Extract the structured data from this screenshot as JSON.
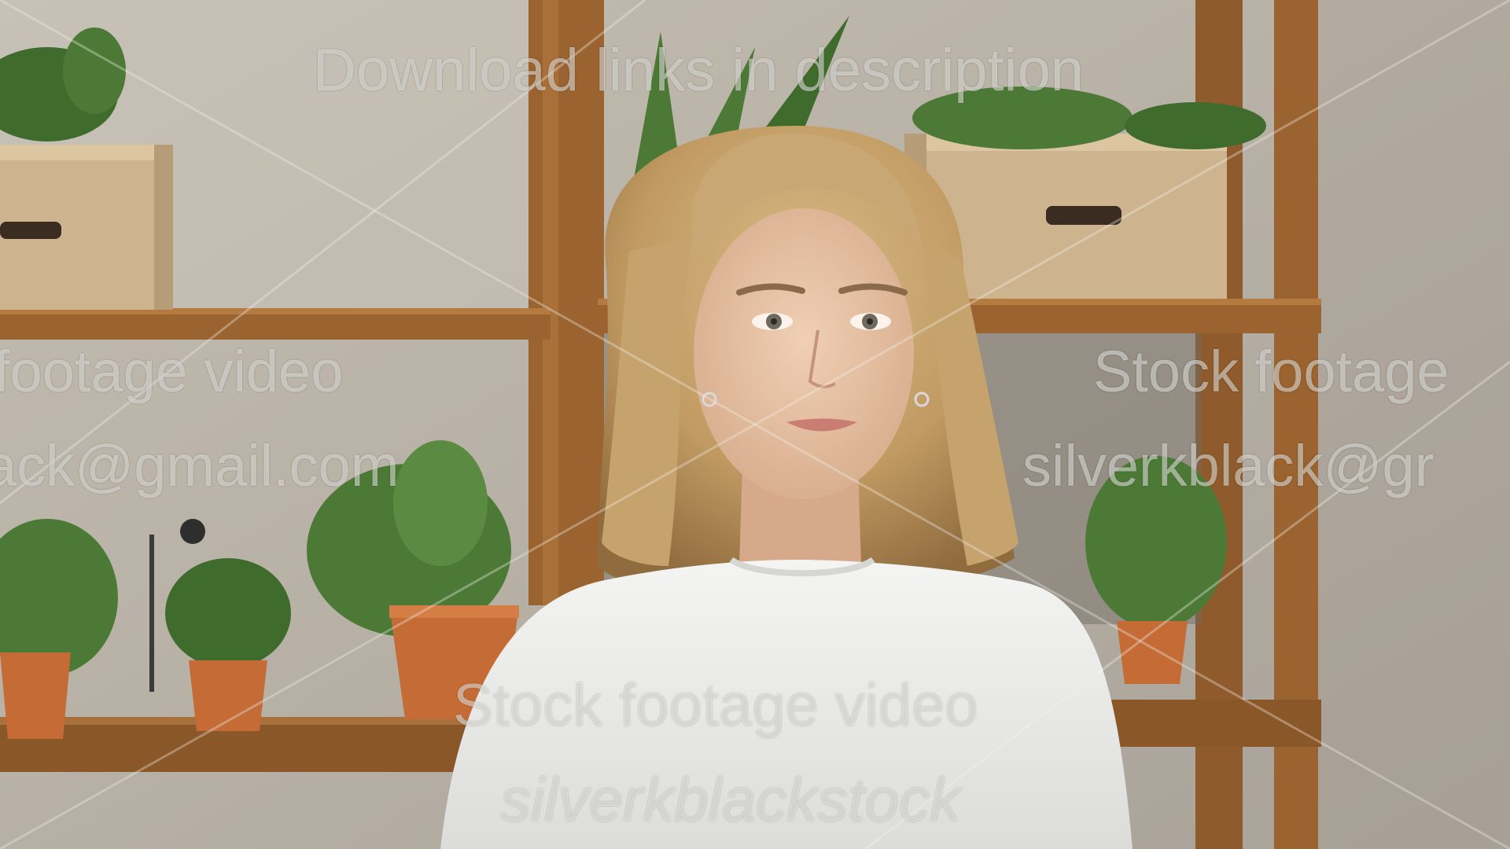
{
  "image": {
    "subject": "woman-portrait",
    "palette": {
      "wall": "#bdb6ab",
      "shelf_wood": "#9a6330",
      "cardboard": "#cdb48e",
      "plant_green": "#4c7a36",
      "terracotta": "#c56c36",
      "hair": "#c9a774",
      "skin": "#e7c3a6",
      "shirt": "#eeeeee",
      "watermark": "#f5f5f0"
    }
  },
  "watermarks": {
    "top": "Download links in description",
    "left_line_1": "footage video",
    "right_line_1": "Stock footage",
    "left_line_2": "ack@gmail.com",
    "right_line_2": "silverkblack@gr",
    "center_line_1": "Stock footage video",
    "center_line_2": "silverkblackstock"
  }
}
